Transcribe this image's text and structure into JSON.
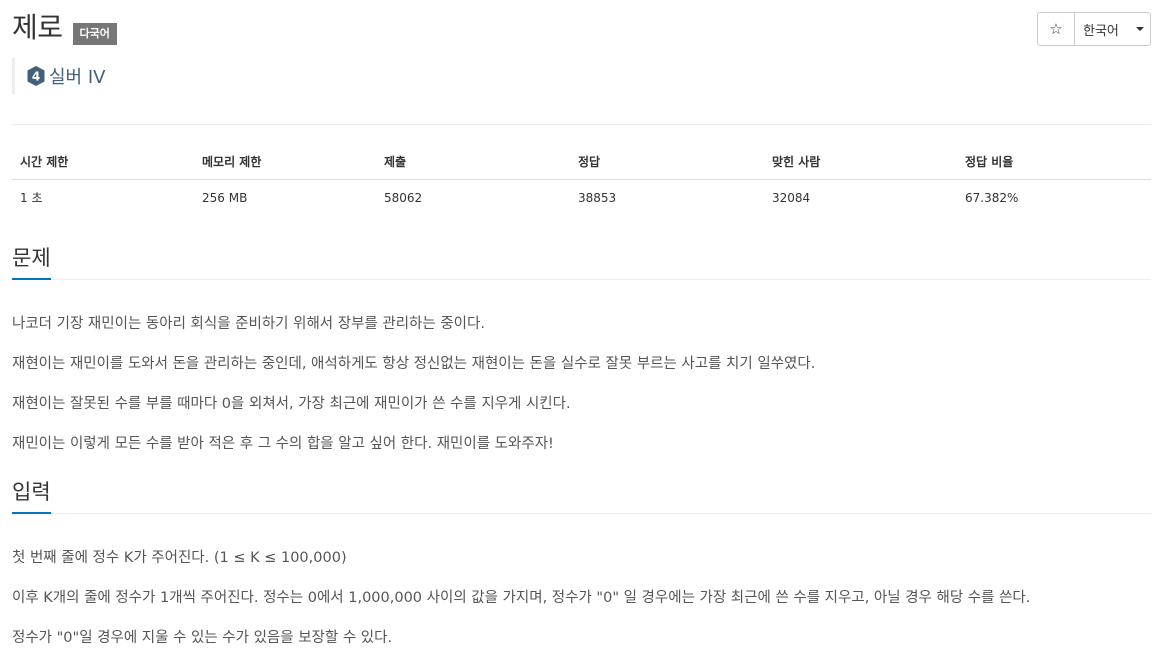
{
  "header": {
    "title": "제로",
    "multilang_badge": "다국어",
    "star_icon": "☆",
    "language_button": "한국어"
  },
  "tier": {
    "icon_number": "4",
    "label": "실버 IV",
    "color": "#435f7a"
  },
  "stats": {
    "headers": [
      "시간 제한",
      "메모리 제한",
      "제출",
      "정답",
      "맞힌 사람",
      "정답 비율"
    ],
    "values": [
      "1 초",
      "256 MB",
      "58062",
      "38853",
      "32084",
      "67.382%"
    ]
  },
  "problem": {
    "heading": "문제",
    "paragraphs": [
      "나코더 기장 재민이는 동아리 회식을 준비하기 위해서 장부를 관리하는 중이다.",
      "재현이는 재민이를 도와서 돈을 관리하는 중인데, 애석하게도 항상 정신없는 재현이는 돈을 실수로 잘못 부르는 사고를 치기 일쑤였다.",
      "재현이는 잘못된 수를 부를 때마다 0을 외쳐서, 가장 최근에 재민이가 쓴 수를 지우게 시킨다.",
      "재민이는 이렇게 모든 수를 받아 적은 후 그 수의 합을 알고 싶어 한다. 재민이를 도와주자!"
    ]
  },
  "input": {
    "heading": "입력",
    "paragraphs": [
      "첫 번째 줄에 정수 K가 주어진다. (1 ≤ K ≤ 100,000)",
      "이후 K개의 줄에 정수가 1개씩 주어진다. 정수는 0에서 1,000,000 사이의 값을 가지며, 정수가 \"0\" 일 경우에는 가장 최근에 쓴 수를 지우고, 아닐 경우 해당 수를 쓴다.",
      "정수가 \"0\"일 경우에 지울 수 있는 수가 있음을 보장할 수 있다."
    ]
  },
  "colors": {
    "accent": "#0076c0",
    "badge_bg": "#777777",
    "text": "#333333"
  }
}
